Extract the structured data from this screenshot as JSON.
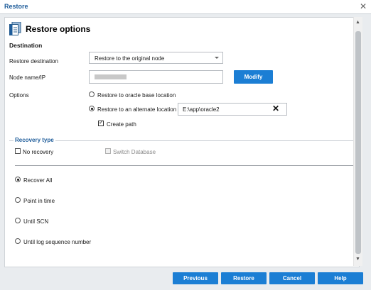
{
  "window": {
    "title": "Restore",
    "close_glyph": "✕"
  },
  "header": {
    "title": "Restore options",
    "icon": "restore-doc-icon"
  },
  "destination": {
    "section_title": "Destination",
    "restore_destination_label": "Restore destination",
    "restore_destination_value": "Restore to the original node",
    "node_label": "Node name/IP",
    "modify_label": "Modify"
  },
  "options": {
    "label": "Options",
    "radio_base": "Restore to oracle base location",
    "radio_alternate": "Restore to an alternate location",
    "alternate_path": "E:\\app\\oracle2",
    "clear_glyph": "✕",
    "create_path": "Create path"
  },
  "recovery": {
    "legend": "Recovery type",
    "no_recovery": "No recovery",
    "switch_database": "Switch Database",
    "recover_all": "Recover All",
    "point_in_time": "Point in time",
    "until_scn": "Until SCN",
    "until_log": "Until log sequence number"
  },
  "footer": {
    "previous": "Previous",
    "restore": "Restore",
    "cancel": "Cancel",
    "help": "Help"
  },
  "colors": {
    "accent": "#1b7ed4",
    "title_blue": "#1e5c9a"
  }
}
